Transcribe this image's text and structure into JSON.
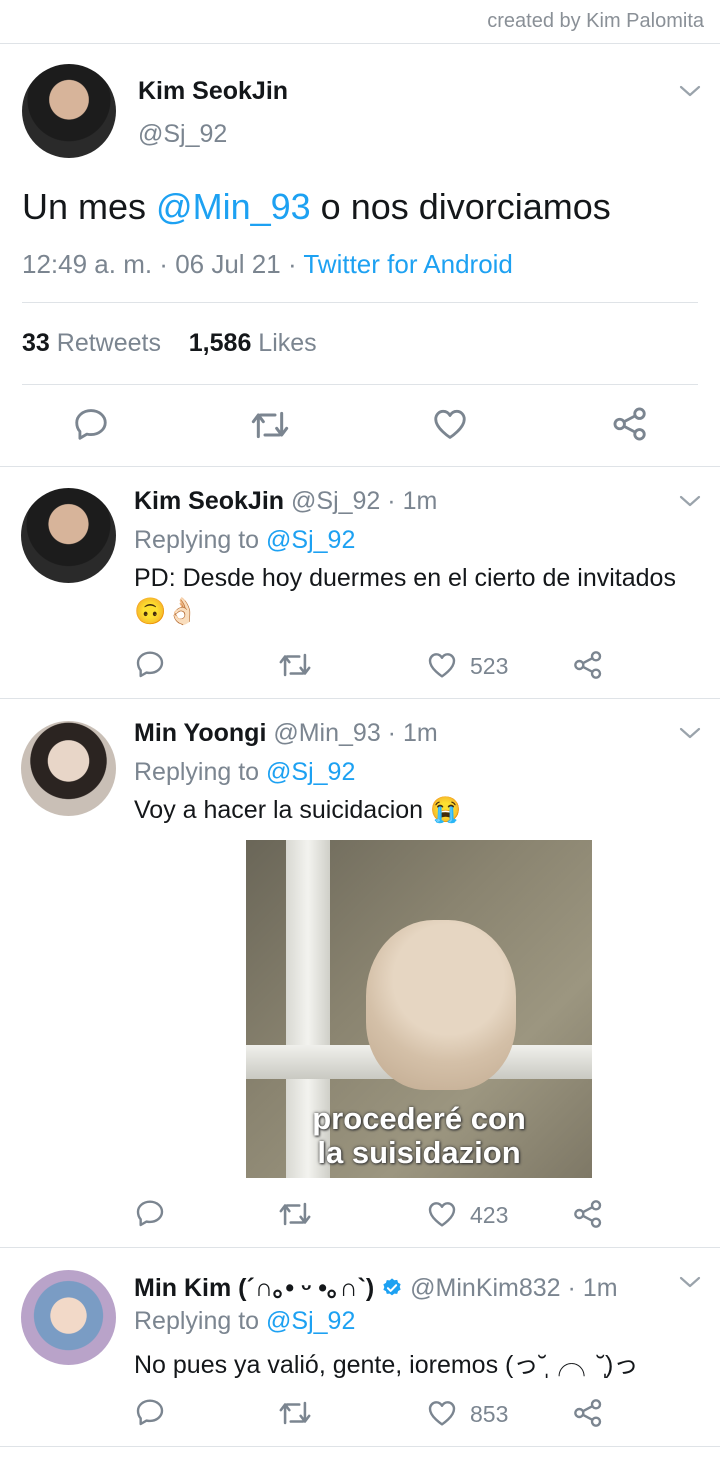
{
  "credit": "created by Kim Palomita",
  "main_tweet": {
    "name": "Kim SeokJin",
    "handle": "@Sj_92",
    "text_before": "Un mes ",
    "mention": "@Min_93",
    "text_after": " o nos divorciamos",
    "time": "12:49 a. m.",
    "sep1": " · ",
    "date": "06 Jul 21",
    "sep2": " · ",
    "client": "Twitter for Android",
    "retweets_count": "33",
    "retweets_label": "Retweets",
    "likes_count": "1,586",
    "likes_label": "Likes"
  },
  "replies": [
    {
      "name": "Kim SeokJin",
      "handle": "@Sj_92",
      "time": "1m",
      "replying_label": "Replying to",
      "replying_to": "@Sj_92",
      "text": "PD: Desde hoy duermes en el cierto de invitados",
      "emojis": "🙃👌🏻",
      "likes": "523"
    },
    {
      "name": "Min Yoongi",
      "handle": "@Min_93",
      "time": "1m",
      "replying_label": "Replying to",
      "replying_to": "@Sj_92",
      "text": "Voy a hacer la suicidacion 😭",
      "image_caption_1": "procederé con",
      "image_caption_2": "la suisidazion",
      "likes": "423"
    },
    {
      "name": "Min Kim (´∩｡• ᵕ •｡∩`)",
      "handle": "@MinKim832",
      "time": "1m",
      "replying_label": "Replying to",
      "replying_to": "@Sj_92",
      "text": "No pues ya valió, gente, ioremos (っ˘̩╭╮˘̩)っ",
      "likes": "853"
    }
  ],
  "colors": {
    "accent": "#1da1f2",
    "muted": "#7b8590",
    "divider": "#dfe3e7"
  },
  "icons": [
    "chevron-down-icon",
    "reply-icon",
    "retweet-icon",
    "like-icon",
    "share-icon",
    "verified-icon"
  ]
}
